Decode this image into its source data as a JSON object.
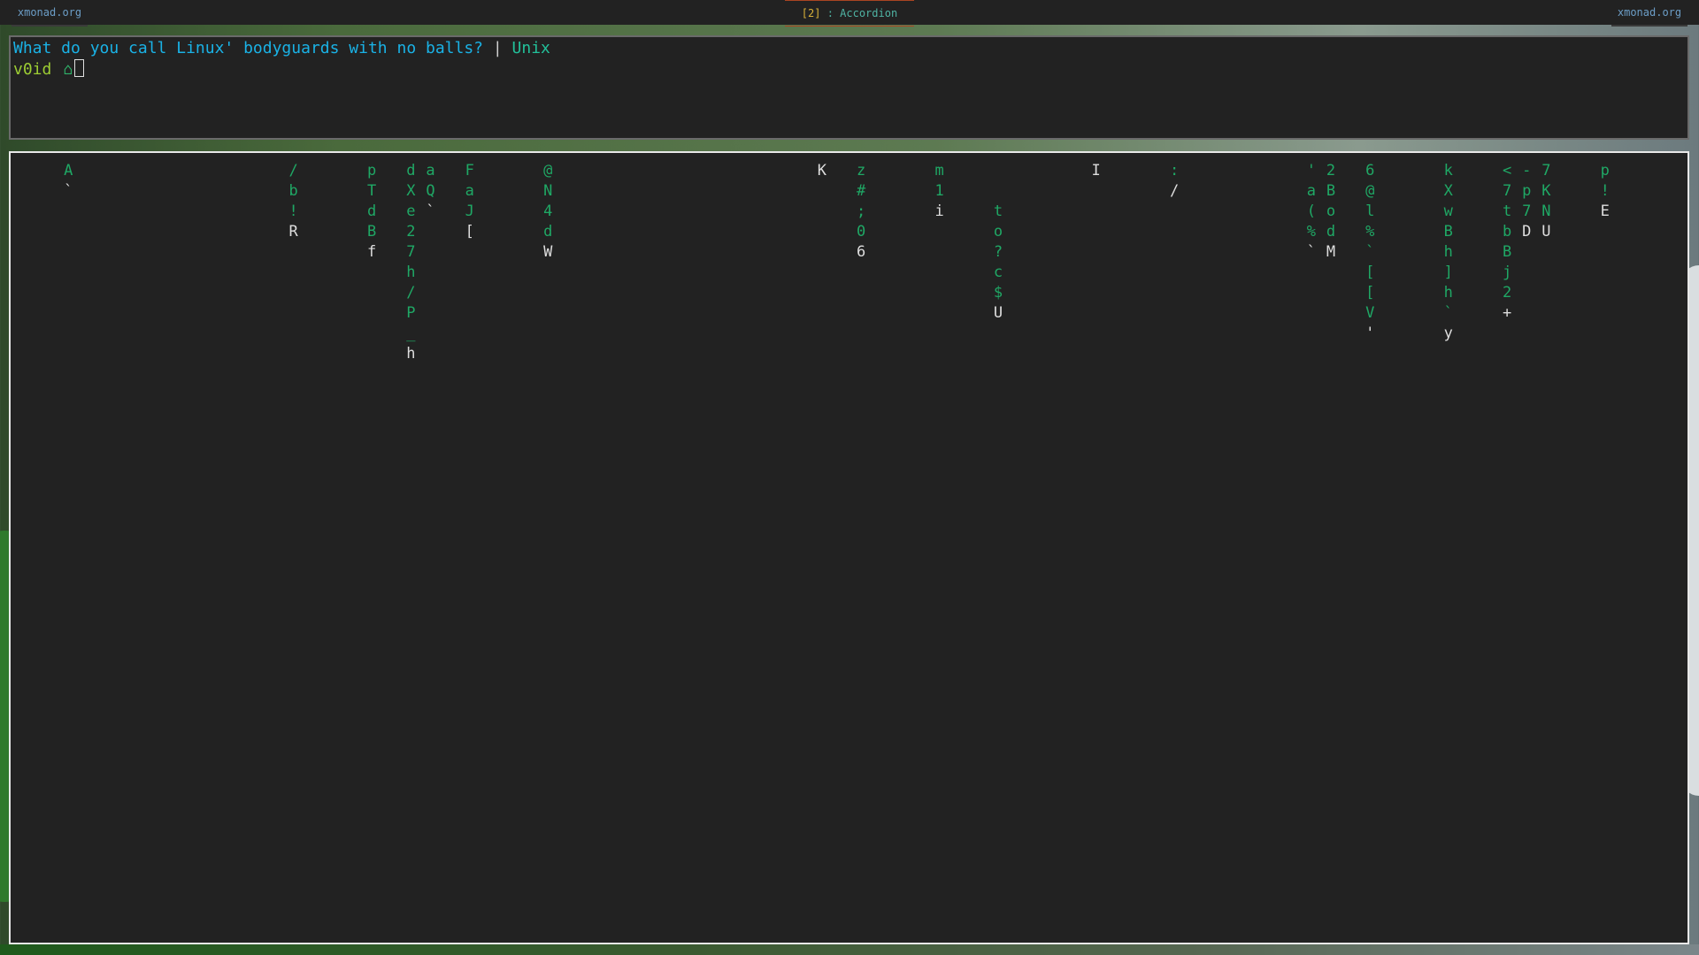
{
  "topbar": {
    "left_tab": "xmonad.org",
    "workspace": "[2]",
    "layout": " : Accordion",
    "right_tab": "xmonad.org"
  },
  "terminal1": {
    "joke_question": "What do you call Linux' bodyguards with no balls?",
    "separator": " | ",
    "joke_answer": "Unix",
    "prompt_user": "v0id",
    "prompt_icon": "home-icon",
    "prompt_icon_glyph": "⌂"
  },
  "matrix_rain": {
    "colors": {
      "trail": "#1fa865",
      "head": "#dedede"
    },
    "columns": [
      {
        "col": 5,
        "row": 0,
        "chars": [
          "A",
          "`"
        ]
      },
      {
        "col": 28,
        "row": 0,
        "chars": [
          "/",
          "b",
          "!",
          "R"
        ]
      },
      {
        "col": 36,
        "row": 0,
        "chars": [
          "p",
          "T",
          "d",
          "B",
          "f"
        ]
      },
      {
        "col": 40,
        "row": 0,
        "chars": [
          "d",
          "X",
          "e",
          "2",
          "7",
          "h",
          "/",
          "P",
          "_",
          "h"
        ]
      },
      {
        "col": 42,
        "row": 0,
        "chars": [
          "a",
          "Q",
          "`"
        ]
      },
      {
        "col": 46,
        "row": 0,
        "chars": [
          "F",
          "a",
          "J",
          "["
        ]
      },
      {
        "col": 54,
        "row": 0,
        "chars": [
          "@",
          "N",
          "4",
          "d",
          "W"
        ]
      },
      {
        "col": 82,
        "row": 0,
        "chars": [
          "K"
        ]
      },
      {
        "col": 86,
        "row": 0,
        "chars": [
          "z",
          "#",
          ";",
          "0",
          "6"
        ]
      },
      {
        "col": 94,
        "row": 0,
        "chars": [
          "m",
          "1",
          "i"
        ]
      },
      {
        "col": 100,
        "row": 2,
        "chars": [
          "t",
          "o",
          "?",
          "c",
          "$",
          "U"
        ]
      },
      {
        "col": 110,
        "row": 0,
        "chars": [
          "I"
        ]
      },
      {
        "col": 118,
        "row": 0,
        "chars": [
          ":",
          "/"
        ]
      },
      {
        "col": 132,
        "row": 0,
        "chars": [
          "'",
          "a",
          "(",
          "%",
          "`"
        ]
      },
      {
        "col": 134,
        "row": 0,
        "chars": [
          "2",
          "B",
          "o",
          "d",
          "M"
        ]
      },
      {
        "col": 138,
        "row": 0,
        "chars": [
          "6",
          "@",
          "l",
          "%",
          "`",
          "[",
          "[",
          "V",
          "'"
        ]
      },
      {
        "col": 146,
        "row": 0,
        "chars": [
          "k",
          "X",
          "w",
          "B",
          "h",
          "]",
          "h",
          "`",
          "y"
        ]
      },
      {
        "col": 152,
        "row": 0,
        "chars": [
          "<",
          "7",
          "t",
          "b",
          "B",
          "j",
          "2",
          "+"
        ]
      },
      {
        "col": 154,
        "row": 0,
        "chars": [
          "-",
          "p",
          "7",
          "D"
        ]
      },
      {
        "col": 156,
        "row": 0,
        "chars": [
          "7",
          "K",
          "N",
          "U"
        ]
      },
      {
        "col": 162,
        "row": 0,
        "chars": [
          "p",
          "!",
          "E"
        ]
      }
    ]
  }
}
